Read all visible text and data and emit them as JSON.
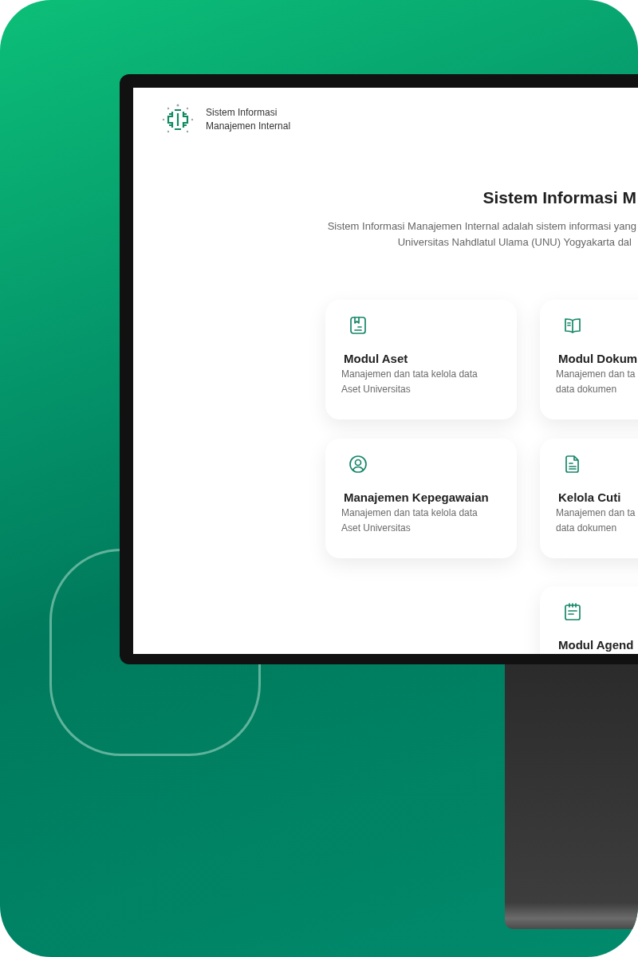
{
  "app": {
    "name_line_1": "Sistem Informasi",
    "name_line_2": "Manajemen Internal"
  },
  "hero": {
    "title": "Sistem Informasi M",
    "description_line_1": "Sistem Informasi Manajemen Internal adalah sistem informasi yang",
    "description_line_2": "Universitas Nahdlatul Ulama (UNU) Yogyakarta dal"
  },
  "modules": [
    {
      "title": "Modul Aset",
      "description_line_1": "Manajemen dan tata kelola data",
      "description_line_2": "Aset Universitas"
    },
    {
      "title": "Modul Dokum",
      "description_line_1": "Manajemen dan ta",
      "description_line_2": "data dokumen"
    },
    {
      "title": "Manajemen Kepegawaian",
      "description_line_1": "Manajemen dan tata kelola data",
      "description_line_2": "Aset Universitas"
    },
    {
      "title": "Kelola Cuti",
      "description_line_1": "Manajemen dan ta",
      "description_line_2": "data dokumen"
    },
    {
      "title": "Modul Agend"
    }
  ]
}
